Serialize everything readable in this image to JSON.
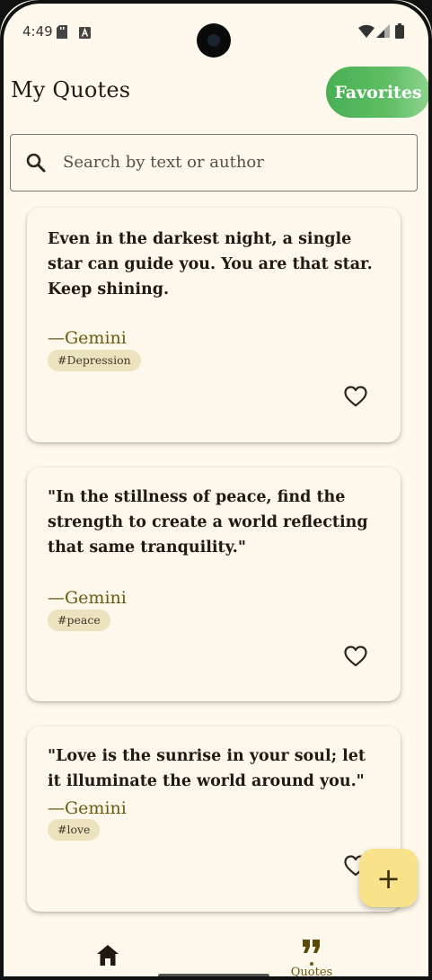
{
  "status_bar": {
    "time": "4:49"
  },
  "header": {
    "title": "My Quotes",
    "favorites_label": "Favorites"
  },
  "search": {
    "placeholder": "Search by text or author",
    "value": ""
  },
  "quotes": [
    {
      "text": "Even in the darkest night, a single star can guide you. You are that star. Keep shining.",
      "author": "—Gemini",
      "tag": "#Depression",
      "favorited": false
    },
    {
      "text": "\"In the stillness of peace, find the strength to create a world reflecting that same tranquility.\"",
      "author": "—Gemini",
      "tag": "#peace",
      "favorited": false
    },
    {
      "text": "\"Love is the sunrise in your soul; let it illuminate the world around you.\"",
      "author": "—Gemini",
      "tag": "#love",
      "favorited": false
    }
  ],
  "fab": {
    "label": "+"
  },
  "bottom_nav": {
    "items": [
      {
        "icon": "home-icon",
        "label": "",
        "active": false
      },
      {
        "icon": "quote-icon",
        "label": "Quotes",
        "active": true
      }
    ]
  },
  "colors": {
    "background": "#FEF9EC",
    "accent_green": "#48B054",
    "fab": "#F9E38A",
    "tag_bg": "#EDE2BE",
    "author": "#6b5a10"
  }
}
